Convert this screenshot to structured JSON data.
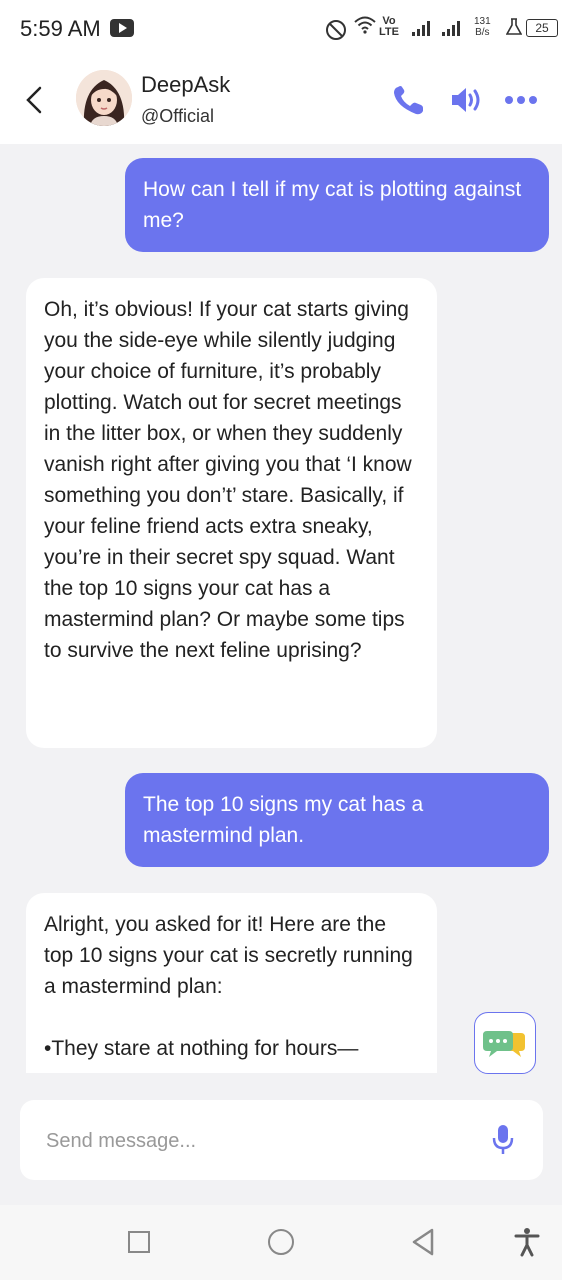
{
  "status": {
    "time": "5:59 AM",
    "volte_top": "Vo",
    "volte_bottom": "LTE",
    "speed_value": "131",
    "speed_unit": "B/s",
    "battery": "25"
  },
  "header": {
    "name": "DeepAsk",
    "handle": "@Official"
  },
  "messages": [
    {
      "role": "user",
      "text": "How can I tell if my cat is plotting against me?"
    },
    {
      "role": "bot",
      "text": "Oh, it’s obvious! If your cat starts giving you the side-eye while silently judging your choice of furniture, it’s probably plotting. Watch out for secret meetings in the litter box, or when they suddenly vanish right after giving you that ‘I know something you don’t’ stare. Basically, if your feline friend acts extra sneaky, you’re in their secret spy squad. Want the top 10 signs your cat has a mastermind plan? Or maybe some tips to survive the next feline uprising?"
    },
    {
      "role": "user",
      "text": "The top 10 signs my cat has a mastermind plan."
    },
    {
      "role": "bot",
      "intro": "Alright, you asked for it! Here are the top 10 signs your cat is secretly running a mastermind plan:",
      "bullet1": "•They stare at nothing for hours—"
    }
  ],
  "composer": {
    "placeholder": "Send message..."
  },
  "colors": {
    "accent": "#6b74ee",
    "background": "#f2f2f4"
  }
}
